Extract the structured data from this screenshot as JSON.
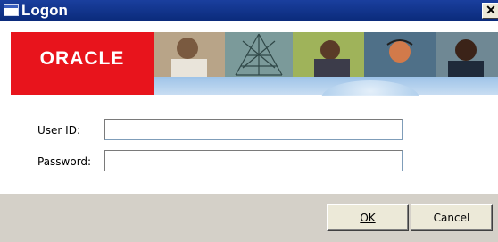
{
  "window": {
    "title": "Logon",
    "close_glyph": "✕",
    "title_icon": "window-icon"
  },
  "banner": {
    "logo_text": "ORACLE",
    "brand_color": "#e8141c"
  },
  "form": {
    "user_id_label": "User ID:",
    "user_id_value": "",
    "password_label": "Password:",
    "password_value": ""
  },
  "buttons": {
    "ok_label": "OK",
    "cancel_label": "Cancel"
  }
}
